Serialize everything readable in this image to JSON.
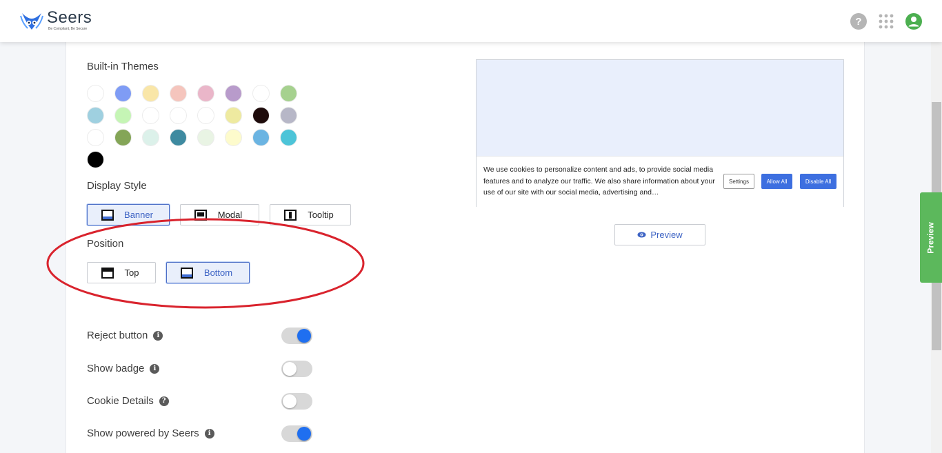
{
  "header": {
    "brand": "Seers",
    "tagline": "Be Compliant, Be Secure",
    "icons": [
      "help-icon",
      "apps-grid-icon",
      "user-avatar-icon"
    ]
  },
  "themes": {
    "label": "Built-in Themes",
    "colors": [
      "#ffffff",
      "#7f9cf5",
      "#f9e6a8",
      "#f5c5bd",
      "#eab6c9",
      "#b89bcb",
      "#ffffff",
      "#a6d18f",
      "#9fd0e0",
      "#c5f5b5",
      "#ffffff",
      "#ffffff",
      "#ffffff",
      "#eeeaa0",
      "#1e0b0b",
      "#b7b7c7",
      "#ffffff",
      "#84a557",
      "#dcf1ea",
      "#3e8aa0",
      "#e9f4e4",
      "#fdfbcc",
      "#6bb4e2",
      "#4dc4d8",
      "#000000"
    ]
  },
  "display_style": {
    "label": "Display Style",
    "options": [
      "Banner",
      "Modal",
      "Tooltip"
    ],
    "selected": "Banner"
  },
  "position": {
    "label": "Position",
    "options": [
      "Top",
      "Bottom"
    ],
    "selected": "Bottom"
  },
  "toggles": [
    {
      "label": "Reject button",
      "on": true,
      "icon": "info-icon"
    },
    {
      "label": "Show badge",
      "on": false,
      "icon": "info-icon"
    },
    {
      "label": "Cookie Details",
      "on": false,
      "icon": "help-icon"
    },
    {
      "label": "Show powered by Seers",
      "on": true,
      "icon": "info-icon"
    }
  ],
  "preview": {
    "banner_text": "We use cookies to personalize content and ads, to provide social media features and to analyze our traffic. We also share information about your use of our site with our social media, advertising and…",
    "settings_label": "Settings",
    "allow_label": "Allow All",
    "disable_label": "Disable All",
    "preview_button": "Preview",
    "side_tab": "Preview"
  },
  "colors": {
    "accent": "#3d6fe0",
    "side_tab": "#5cb85c",
    "annotation": "#d9232d"
  }
}
